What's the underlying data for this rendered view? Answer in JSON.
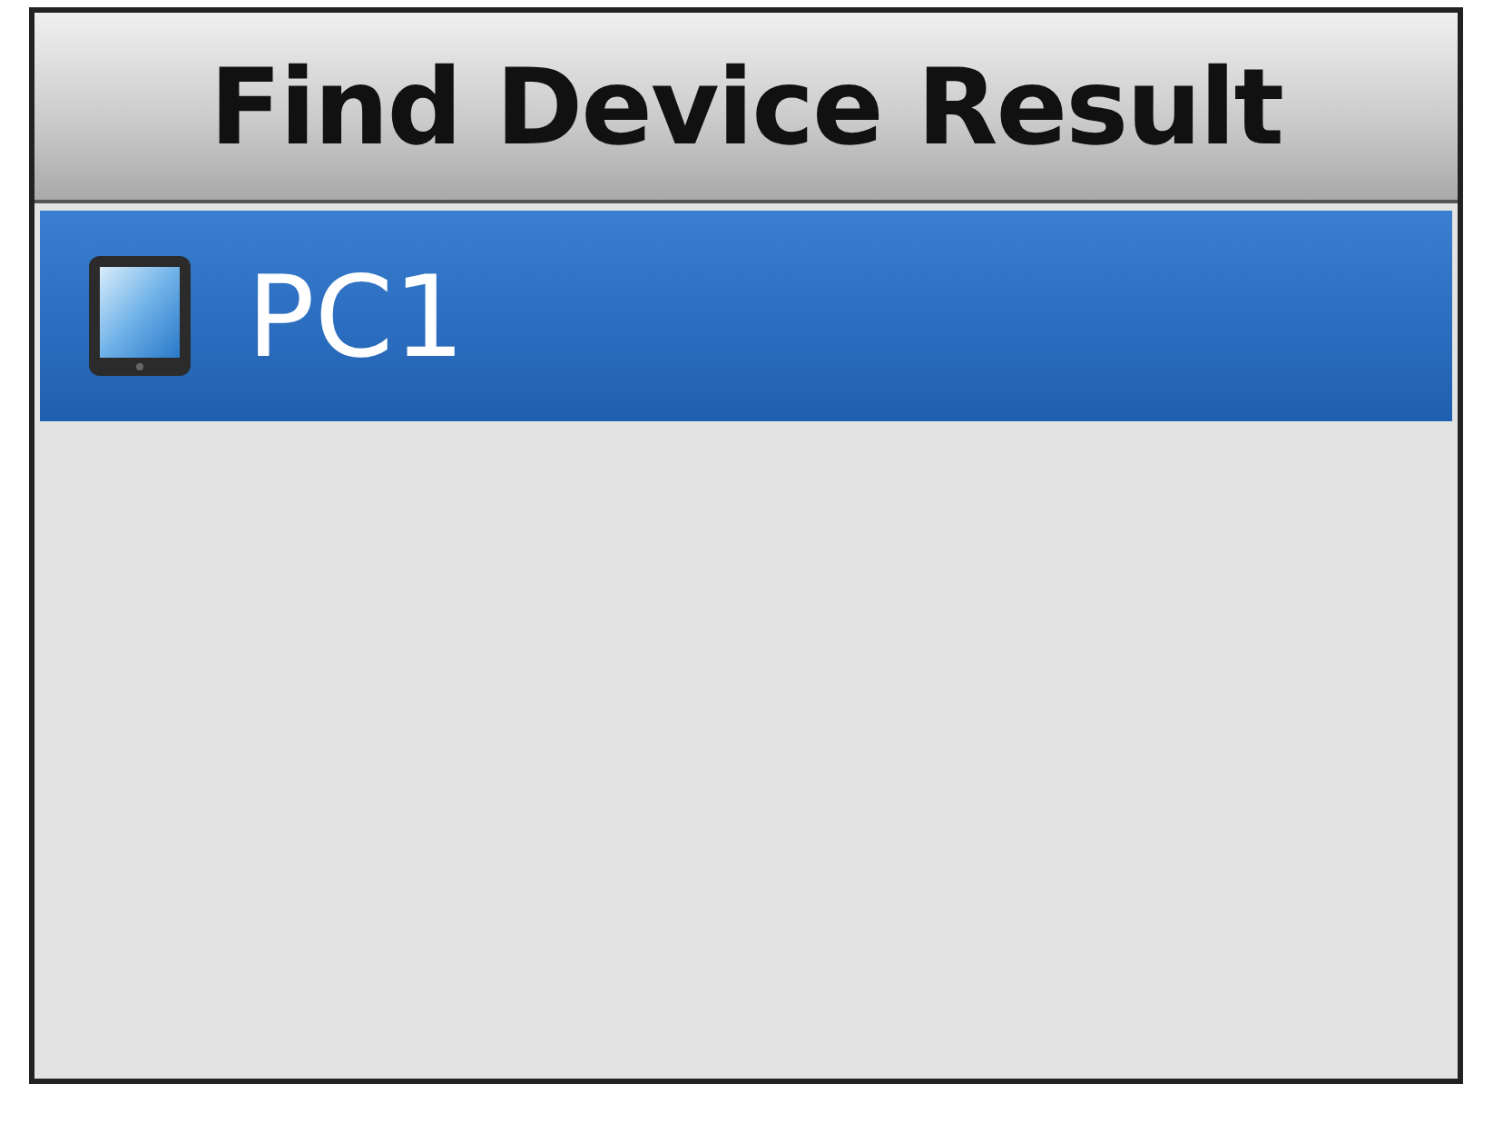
{
  "title": "Find Device Result",
  "results": [
    {
      "label": "PC1",
      "selected": true
    }
  ]
}
